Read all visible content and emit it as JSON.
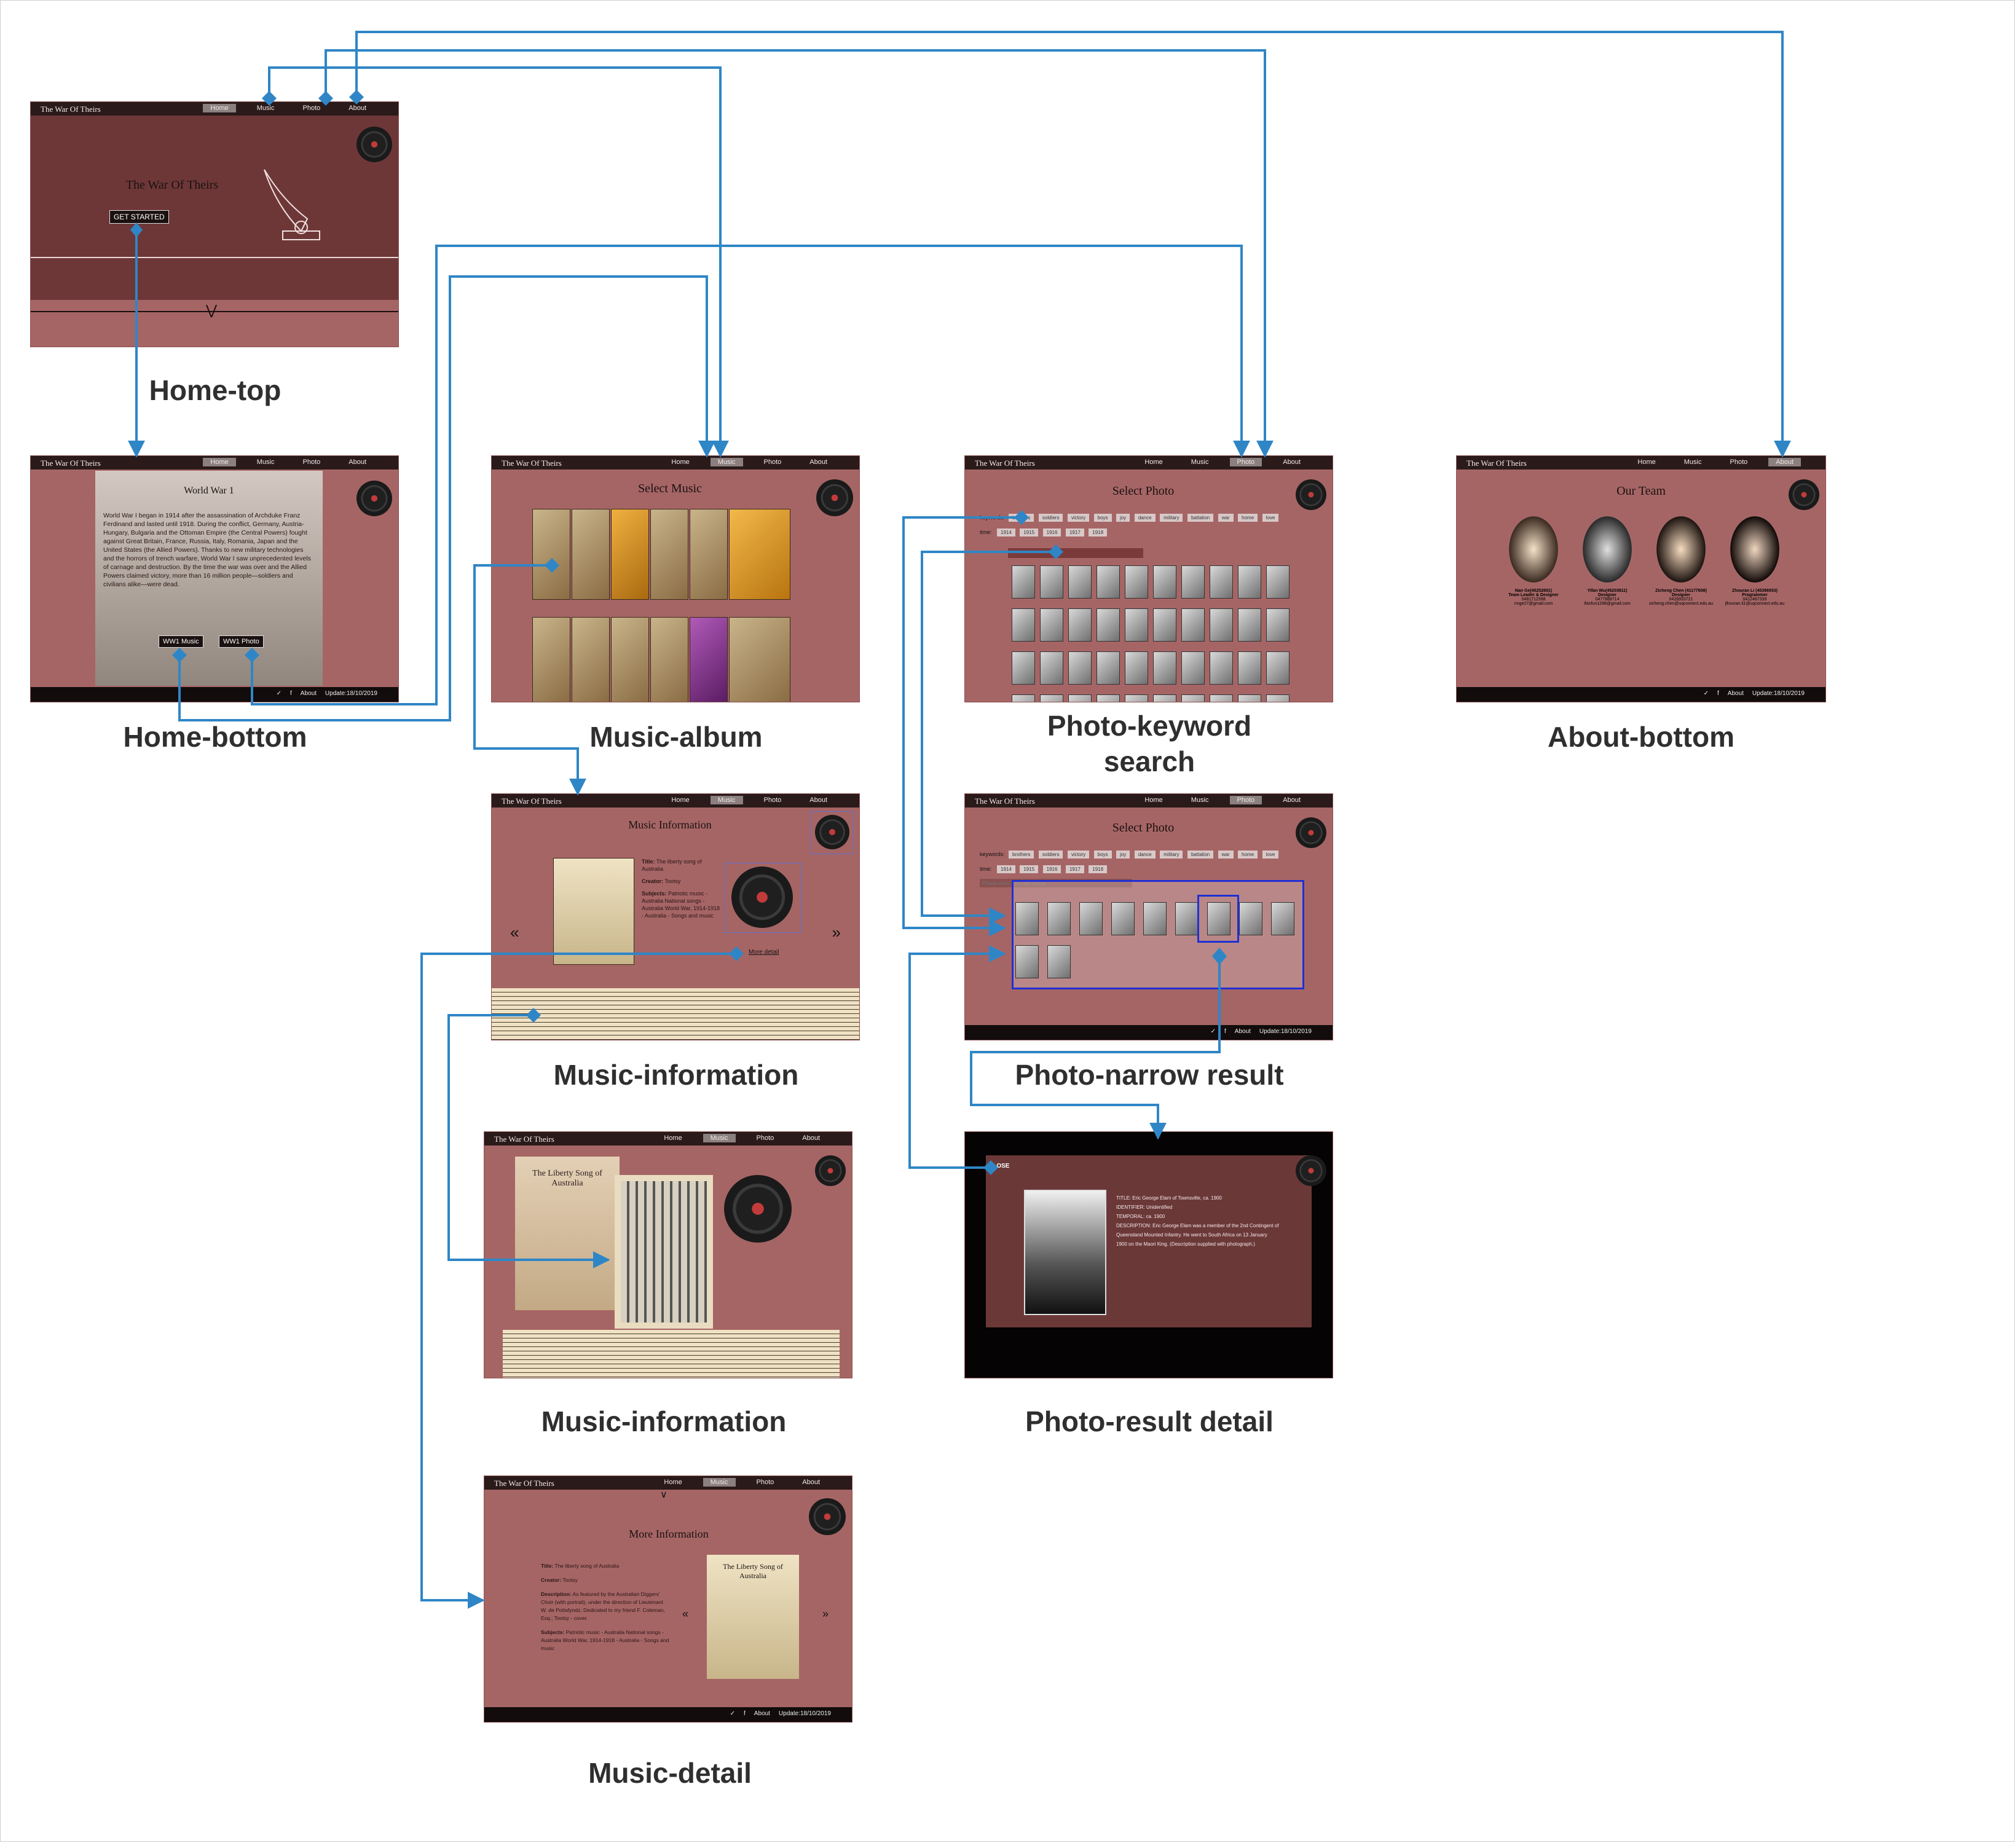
{
  "brand": "The War Of Theirs",
  "nav": [
    "Home",
    "Music",
    "Photo",
    "About"
  ],
  "footer": {
    "about": "About",
    "update": "Update:18/10/2019"
  },
  "screens": {
    "home_top": {
      "caption": "Home-top",
      "title": "The War Of Theirs",
      "button": "GET STARTED"
    },
    "home_bottom": {
      "caption": "Home-bottom",
      "heading": "World War 1",
      "body": "World War I began in 1914 after the assassination of Archduke Franz Ferdinand and lasted until 1918. During the conflict, Germany, Austria-Hungary, Bulgaria and the Ottoman Empire (the Central Powers) fought against Great Britain, France, Russia, Italy, Romania, Japan and the United States (the Allied Powers). Thanks to new military technologies and the horrors of trench warfare, World War I saw unprecedented levels of carnage and destruction. By the time the war was over and the Allied Powers claimed victory, more than 16 million people—soldiers and civilians alike—were dead.",
      "music_button": "WW1 Music",
      "photo_button": "WW1 Photo"
    },
    "music_album": {
      "caption": "Music-album",
      "heading": "Select Music"
    },
    "photo_keyword": {
      "caption_line1": "Photo-keyword",
      "caption_line2": "search",
      "heading": "Select Photo",
      "keyword_label": "keywords:",
      "keywords": [
        "brothers",
        "soldiers",
        "victory",
        "boys",
        "joy",
        "dance",
        "military",
        "battalion",
        "war",
        "home",
        "love"
      ],
      "time_label": "time:",
      "years": [
        "1914",
        "1915",
        "1916",
        "1917",
        "1918"
      ]
    },
    "about_bottom": {
      "caption": "About-bottom",
      "heading": "Our Team",
      "members": [
        {
          "name": "Nan Ge(45252691)",
          "role": "Team Leader & Designer",
          "mobile": "0481712398",
          "email": "nnge27@gmail.com"
        },
        {
          "name": "Yifan Wu(45203811)",
          "role": "Designer",
          "mobile": "0477888714",
          "email": "ifanfun1298@gmail.com"
        },
        {
          "name": "Zicheng Chen (41177608)",
          "role": "Designer",
          "mobile": "0426933721",
          "email": "zicheng.chen@uqconnect.edu.au"
        },
        {
          "name": "Zhouran Li (45396553)",
          "role": "Programmer",
          "mobile": "0412467339",
          "email": "jlhouran.li1@uqconnect.edu.au"
        }
      ]
    },
    "music_info": {
      "caption": "Music-information",
      "heading": "Music Information",
      "title_label": "Title:",
      "title_value": "The liberty song of Australia",
      "creator_label": "Creator:",
      "creator_value": "Tootsy",
      "subjects_label": "Subjects:",
      "subjects_value": "Patriotic music - Australia National songs - Australia World War, 1914-1918 - Australia - Songs and music",
      "more_link": "More detail",
      "prev": "«",
      "next": "»"
    },
    "music_info2": {
      "caption": "Music-information",
      "sheet_title": "The Liberty Song of Australia"
    },
    "photo_narrow": {
      "caption": "Photo-narrow result",
      "heading": "Select Photo",
      "placeholder": "Please enter your own words"
    },
    "photo_detail": {
      "caption": "Photo-result detail",
      "close": "CLOSE",
      "lines": [
        "TITLE: Eric George Elam of Townsville, ca. 1900",
        "IDENTIFIER: Unidentified",
        "TEMPORAL: ca. 1900",
        "DESCRIPTION: Eric George Elam was a member of the 2nd Contingent of",
        "Queensland Mounted Infantry. He went to South Africa on 13 January",
        "1900 on the Maori King. (Description supplied with photograph.)"
      ]
    },
    "music_detail": {
      "caption": "Music-detail",
      "heading": "More Information",
      "title_label": "Title:",
      "title_value": "The liberty song of Australia",
      "creator_label": "Creator:",
      "creator_value": "Tootsy",
      "description_label": "Description:",
      "description_value": "As featured by the Australian Diggers' Choir (with portrait), under the direction of Lieutenant W. de Pottafyndz; Dedicated to my friend F. Coleman, Esq.; Tootsy - cover.",
      "subjects_label": "Subjects:",
      "subjects_value": "Patriotic music - Australia National songs - Australia World War, 1914-1918 - Australia - Songs and music",
      "sheet_title": "The Liberty Song of Australia",
      "prev": "«",
      "next": "»"
    }
  },
  "colors": {
    "arrow": "#2f86c6",
    "page_bg": "#a66565",
    "nav_bg": "#2a1a1a",
    "highlight": "#1f2fd6"
  }
}
